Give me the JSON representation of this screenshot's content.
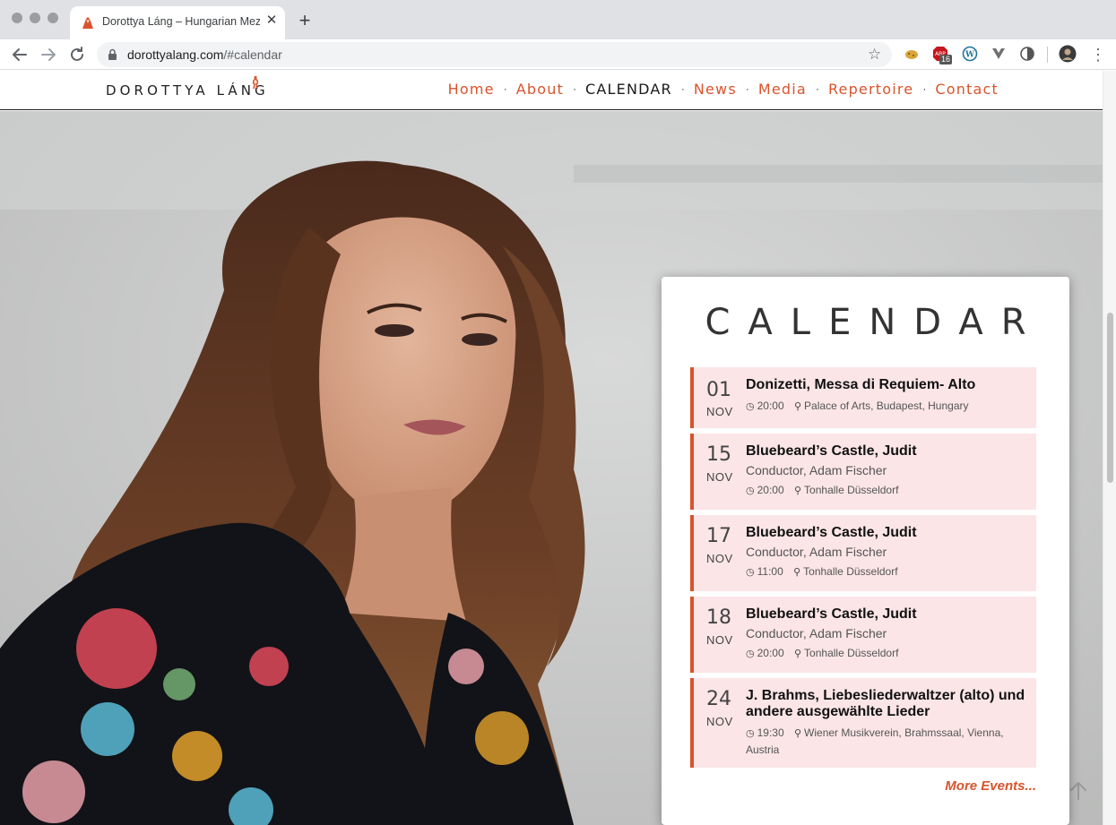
{
  "browser": {
    "tab_title": "Dorottya Láng – Hungarian Mez",
    "url_host": "dorottyalang.com",
    "url_path": "/#calendar",
    "close_glyph": "✕",
    "newtab_glyph": "+",
    "extension_badge": "16"
  },
  "site": {
    "logo_text": "DOROTTYA LÁNG",
    "nav": [
      {
        "label": "Home"
      },
      {
        "label": "About"
      },
      {
        "label": "CALENDAR",
        "active": true
      },
      {
        "label": "News"
      },
      {
        "label": "Media"
      },
      {
        "label": "Repertoire"
      },
      {
        "label": "Contact"
      }
    ],
    "nav_separator": "·",
    "accent_color": "#d9532c"
  },
  "calendar": {
    "title": "CALENDAR",
    "events": [
      {
        "day": "01",
        "month": "NOV",
        "title": "Donizetti, Messa di Requiem- Alto",
        "subtitle": "",
        "time": "20:00",
        "location": "Palace of Arts, Budapest, Hungary"
      },
      {
        "day": "15",
        "month": "NOV",
        "title": "Bluebeard’s Castle, Judit",
        "subtitle": "Conductor, Adam Fischer",
        "time": "20:00",
        "location": "Tonhalle Düsseldorf"
      },
      {
        "day": "17",
        "month": "NOV",
        "title": "Bluebeard’s Castle, Judit",
        "subtitle": "Conductor, Adam Fischer",
        "time": "11:00",
        "location": "Tonhalle Düsseldorf"
      },
      {
        "day": "18",
        "month": "NOV",
        "title": "Bluebeard’s Castle, Judit",
        "subtitle": "Conductor, Adam Fischer",
        "time": "20:00",
        "location": "Tonhalle Düsseldorf"
      },
      {
        "day": "24",
        "month": "NOV",
        "title": "J. Brahms, Liebesliederwaltzer (alto) und andere ausgewählte Lieder",
        "subtitle": "",
        "time": "19:30",
        "location": "Wiener Musikverein, Brahmssaal, Vienna, Austria"
      }
    ],
    "more_label": "More Events..."
  },
  "icons": {
    "clock": "clock-icon",
    "pin": "map-pin-icon",
    "to_top": "arrow-up-icon"
  }
}
